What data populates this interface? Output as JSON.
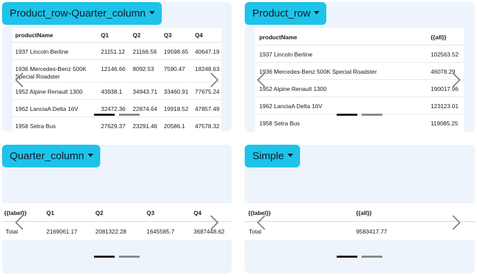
{
  "panels": {
    "p1": {
      "title": "Product_row-Quarter_column",
      "headers": [
        "productName",
        "Q1",
        "Q2",
        "Q3",
        "Q4"
      ],
      "rows": [
        [
          "1937 Lincoln Berline",
          "21151.12",
          "21166.56",
          "19598.65",
          "40647.19"
        ],
        [
          "1936 Mercedes-Benz 500K Special Roadster",
          "12146.66",
          "8092.53",
          "7590.47",
          "18248.63"
        ],
        [
          "1952 Alpine Renault 1300",
          "43938.1",
          "34943.71",
          "33460.91",
          "77675.24"
        ],
        [
          "1962 LanciaA Delta 16V",
          "32472.36",
          "22874.64",
          "19918.52",
          "47857.49"
        ],
        [
          "1958 Setra Bus",
          "27629.37",
          "23291.46",
          "20586.1",
          "47578.32"
        ]
      ]
    },
    "p2": {
      "title": "Product_row",
      "headers": [
        "productName",
        "{{all}}"
      ],
      "rows": [
        [
          "1937 Lincoln Berline",
          "102563.52"
        ],
        [
          "1936 Mercedes-Benz 500K Special Roadster",
          "46078.29"
        ],
        [
          "1952 Alpine Renault 1300",
          "190017.96"
        ],
        [
          "1962 LanciaA Delta 16V",
          "123123.01"
        ],
        [
          "1958 Setra Bus",
          "119085.25"
        ]
      ]
    },
    "p3": {
      "title": "Quarter_column",
      "headers": [
        "{{label}}",
        "Q1",
        "Q2",
        "Q3",
        "Q4"
      ],
      "rows": [
        [
          "Total",
          "2169061.17",
          "2081322.28",
          "1645585.7",
          "3687448.62"
        ]
      ]
    },
    "p4": {
      "title": "Simple",
      "headers": [
        "{{label}}",
        "{{all}}"
      ],
      "rows": [
        [
          "Total",
          "9583417.77"
        ]
      ]
    }
  },
  "icons": {
    "prev": "chevron-left-icon",
    "next": "chevron-right-icon",
    "caret": "caret-down-icon"
  },
  "colors": {
    "panel_bg": "#eef4fc",
    "dropdown_bg": "#1ec3ea",
    "dot_active": "#111111",
    "dot_inactive": "#888888"
  }
}
